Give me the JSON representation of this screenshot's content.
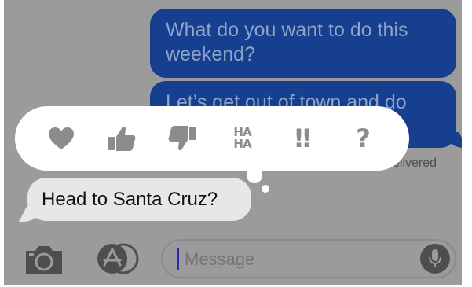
{
  "conversation": {
    "outgoing": [
      {
        "text": "What do you want to do this weekend?"
      },
      {
        "text": "Let’s get out of town and do"
      }
    ],
    "status": "elivered",
    "incoming": [
      {
        "text": "Head to Santa Cruz?"
      }
    ]
  },
  "tapback": {
    "items": [
      {
        "name": "heart-icon",
        "glyph": "♥"
      },
      {
        "name": "thumbs-up-icon",
        "glyph": "👍"
      },
      {
        "name": "thumbs-down-icon",
        "glyph": "👎"
      },
      {
        "name": "haha-icon",
        "line1": "HA",
        "line2": "HA"
      },
      {
        "name": "exclamation-icon",
        "glyph": "‼"
      },
      {
        "name": "question-icon",
        "glyph": "?"
      }
    ]
  },
  "composer": {
    "placeholder": "Message",
    "icons": [
      "camera-icon",
      "app-store-icon",
      "microphone-icon"
    ]
  },
  "colors": {
    "outgoing_bubble": "#163f8f",
    "incoming_bubble": "#e7e7e7",
    "dimmed_background": "#9b9b9b",
    "tapback_icon": "#8c8c8c"
  }
}
